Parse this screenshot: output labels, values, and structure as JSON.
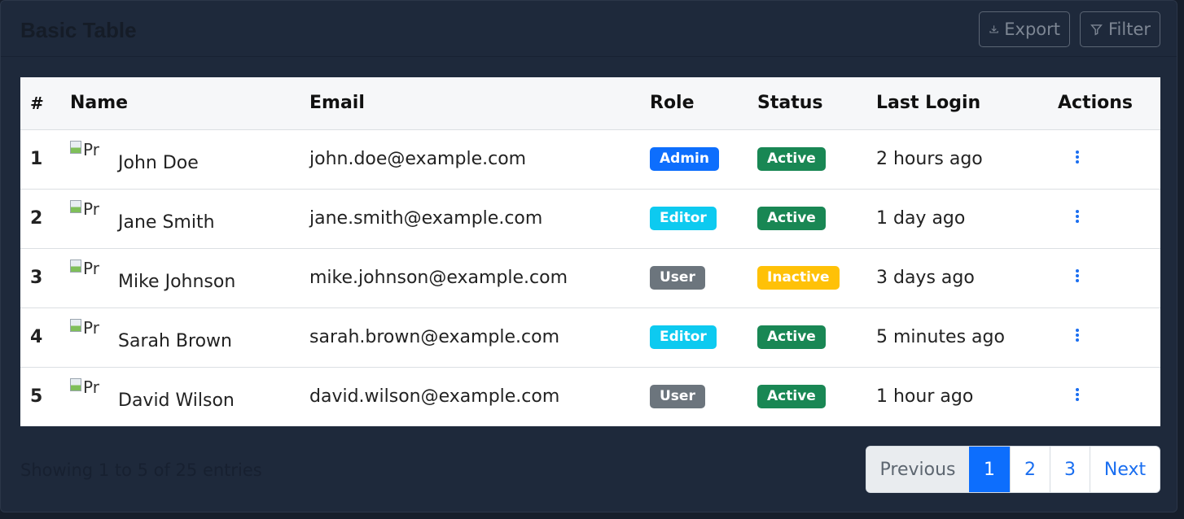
{
  "header": {
    "title": "Basic Table",
    "export_label": "Export",
    "filter_label": "Filter"
  },
  "table": {
    "columns": [
      "#",
      "Name",
      "Email",
      "Role",
      "Status",
      "Last Login",
      "Actions"
    ],
    "avatar_alt": "Pr",
    "rows": [
      {
        "num": "1",
        "name": "John Doe",
        "email": "john.doe@example.com",
        "role": "Admin",
        "role_color": "#0d6efd",
        "status": "Active",
        "status_color": "#198754",
        "last_login": "2 hours ago"
      },
      {
        "num": "2",
        "name": "Jane Smith",
        "email": "jane.smith@example.com",
        "role": "Editor",
        "role_color": "#0dcaf0",
        "status": "Active",
        "status_color": "#198754",
        "last_login": "1 day ago"
      },
      {
        "num": "3",
        "name": "Mike Johnson",
        "email": "mike.johnson@example.com",
        "role": "User",
        "role_color": "#6c757d",
        "status": "Inactive",
        "status_color": "#ffc107",
        "last_login": "3 days ago"
      },
      {
        "num": "4",
        "name": "Sarah Brown",
        "email": "sarah.brown@example.com",
        "role": "Editor",
        "role_color": "#0dcaf0",
        "status": "Active",
        "status_color": "#198754",
        "last_login": "5 minutes ago"
      },
      {
        "num": "5",
        "name": "David Wilson",
        "email": "david.wilson@example.com",
        "role": "User",
        "role_color": "#6c757d",
        "status": "Active",
        "status_color": "#198754",
        "last_login": "1 hour ago"
      }
    ]
  },
  "footer": {
    "summary": "Showing 1 to 5 of 25 entries"
  },
  "pagination": {
    "previous": "Previous",
    "pages": [
      "1",
      "2",
      "3"
    ],
    "active_page": "1",
    "next": "Next"
  },
  "colors": {
    "primary": "#0d6efd",
    "card_bg": "#1e293b"
  }
}
